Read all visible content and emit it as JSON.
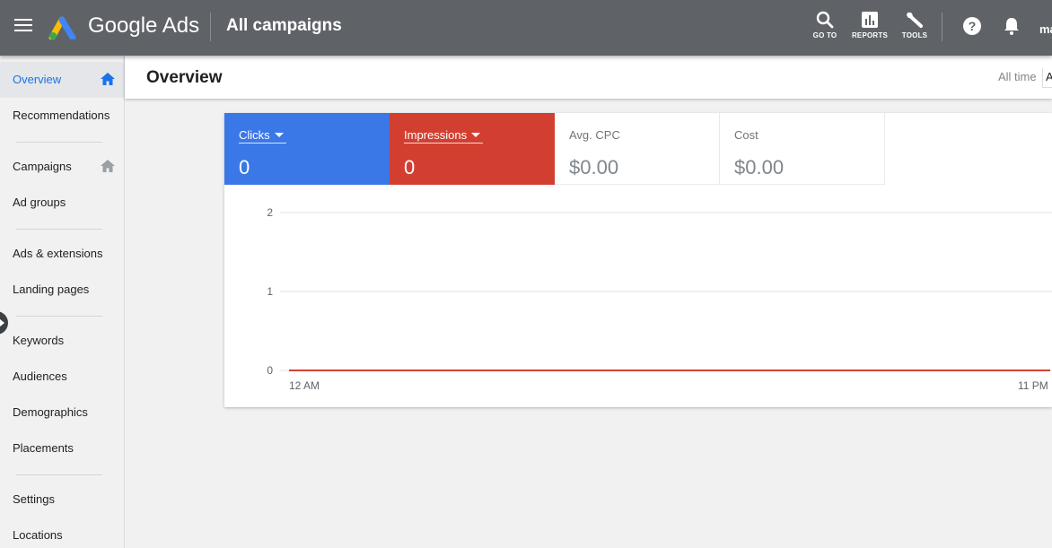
{
  "header": {
    "brand": "Google Ads",
    "title": "All campaigns",
    "tools": [
      {
        "label": "GO TO",
        "icon": "search-icon"
      },
      {
        "label": "REPORTS",
        "icon": "reports-icon"
      },
      {
        "label": "TOOLS",
        "icon": "wrench-icon"
      }
    ],
    "help_icon": "help-icon",
    "notifications_icon": "bell-icon",
    "account_text": "ma"
  },
  "sidebar": {
    "items": [
      {
        "label": "Overview",
        "active": true
      },
      {
        "label": "Recommendations"
      },
      {
        "label": "Campaigns"
      },
      {
        "label": "Ad groups"
      },
      {
        "label": "Ads & extensions"
      },
      {
        "label": "Landing pages"
      },
      {
        "label": "Keywords"
      },
      {
        "label": "Audiences"
      },
      {
        "label": "Demographics"
      },
      {
        "label": "Placements"
      },
      {
        "label": "Settings"
      },
      {
        "label": "Locations"
      }
    ]
  },
  "page": {
    "title": "Overview",
    "date_range_label": "All time",
    "date_range_value": "A"
  },
  "metrics": [
    {
      "name": "Clicks",
      "value": "0",
      "color": "#3b78e7"
    },
    {
      "name": "Impressions",
      "value": "0",
      "color": "#d23f31"
    },
    {
      "name": "Avg. CPC",
      "value": "$0.00"
    },
    {
      "name": "Cost",
      "value": "$0.00"
    }
  ],
  "chart_data": {
    "type": "line",
    "x_labels": [
      "12 AM",
      "11 PM"
    ],
    "y_ticks": [
      0,
      1,
      2
    ],
    "ylim": [
      0,
      2
    ],
    "grid": true,
    "series": [
      {
        "name": "Clicks",
        "color": "#3b78e7",
        "values": [
          0,
          0
        ]
      },
      {
        "name": "Impressions",
        "color": "#d23f31",
        "values": [
          0,
          0
        ]
      }
    ]
  }
}
